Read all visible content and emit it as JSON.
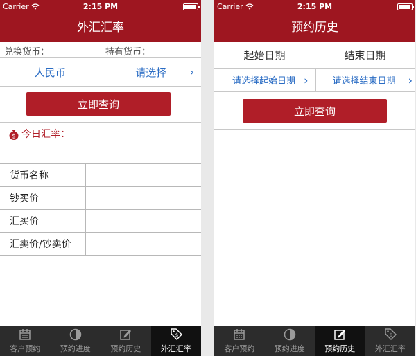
{
  "status": {
    "carrier": "Carrier",
    "time": "2:15 PM"
  },
  "left": {
    "title": "外汇汇率",
    "exchange_label": "兑换货币：",
    "hold_label": "持有货币：",
    "exchange_value": "人民币",
    "hold_value": "请选择",
    "query_label": "立即查询",
    "rate_title": "今日汇率：",
    "table_rows": [
      "货币名称",
      "钞买价",
      "汇买价",
      "汇卖价/钞卖价"
    ]
  },
  "right": {
    "title": "预约历史",
    "start_label": "起始日期",
    "end_label": "结束日期",
    "start_value": "请选择起始日期",
    "end_value": "请选择结束日期",
    "query_label": "立即查询"
  },
  "tabs": [
    "客户预约",
    "预约进度",
    "预约历史",
    "外汇汇率"
  ],
  "left_active_tab": "外汇汇率",
  "right_active_tab": "预约历史",
  "colors": {
    "brand": "#9e1620",
    "button": "#b01e28",
    "link": "#2a6cc4",
    "tabbar": "#2c2c2c"
  }
}
